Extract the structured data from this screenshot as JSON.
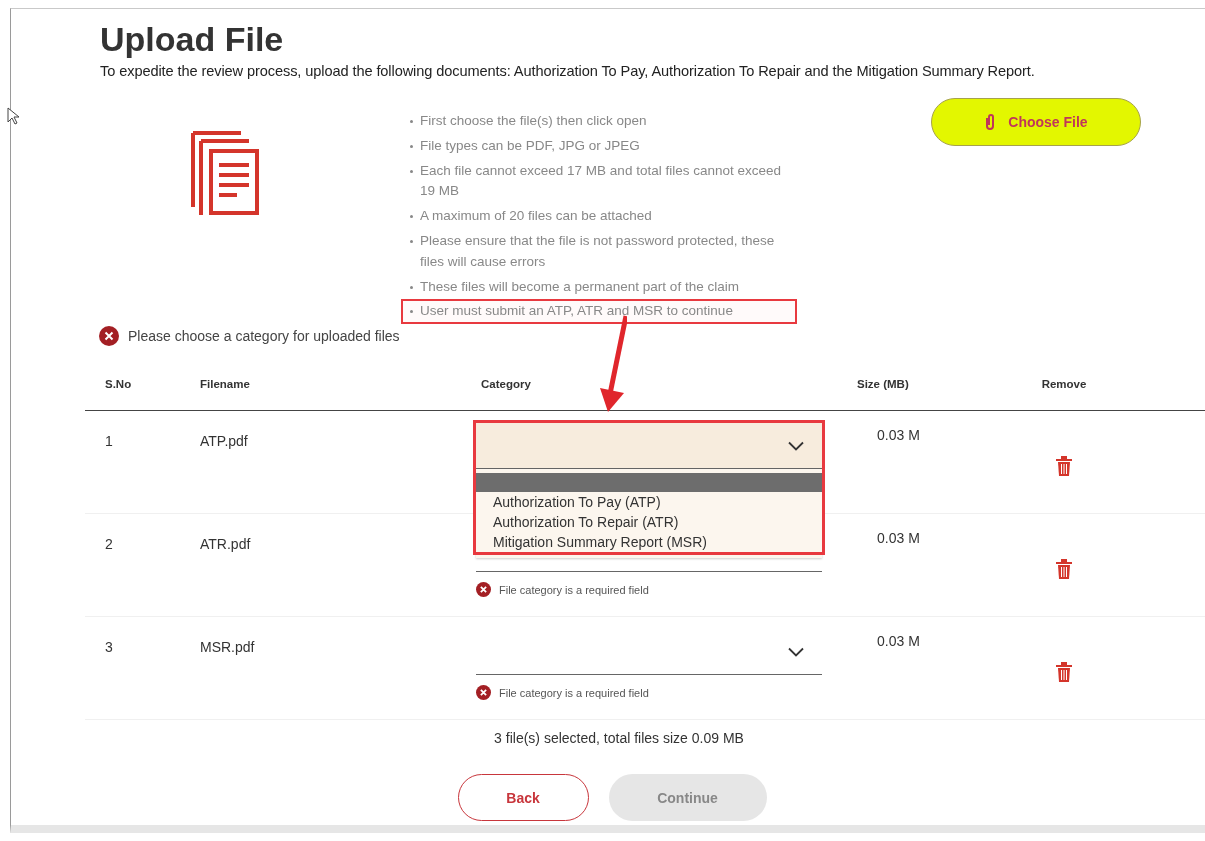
{
  "title": "Upload File",
  "subtitle": "To expedite the review process, upload the following documents: Authorization To Pay, Authorization To Repair and the Mitigation Summary Report.",
  "notes": [
    {
      "text": "First choose the file(s) then click open",
      "highlighted": false
    },
    {
      "text": "File types can be PDF, JPG or JPEG",
      "highlighted": false
    },
    {
      "text": "Each file cannot exceed 17 MB and total files cannot exceed 19 MB",
      "highlighted": false
    },
    {
      "text": "A maximum of 20 files can be attached",
      "highlighted": false
    },
    {
      "text": "Please ensure that the file is not password protected, these files will cause errors",
      "highlighted": false
    },
    {
      "text": "These files will become a permanent part of the claim",
      "highlighted": false
    },
    {
      "text": "User must submit an ATP, ATR and MSR to continue",
      "highlighted": true
    }
  ],
  "choose_button": "Choose File",
  "error_message": "Please choose a category for uploaded files",
  "table": {
    "columns": [
      "S.No",
      "Filename",
      "Category",
      "Size (MB)",
      "Remove"
    ],
    "rows": [
      {
        "sno": "1",
        "filename": "ATP.pdf",
        "size": "0.03 M",
        "expanded": true
      },
      {
        "sno": "2",
        "filename": "ATR.pdf",
        "size": "0.03 M",
        "expanded": false,
        "error": "File category is a required field"
      },
      {
        "sno": "3",
        "filename": "MSR.pdf",
        "size": "0.03 M",
        "expanded": false,
        "error": "File category is a required field"
      }
    ]
  },
  "dropdown": {
    "blank_option_highlighted": true,
    "highlighted": true,
    "options": [
      {
        "label": "Authorization To Pay (ATP)",
        "selected": false
      },
      {
        "label": "Authorization To Repair (ATR)",
        "selected": false
      },
      {
        "label": "Mitigation Summary Report (MSR)",
        "selected": false
      }
    ]
  },
  "annotation_arrow": true,
  "summary": "3 file(s) selected, total files size 0.09 MB",
  "buttons": [
    {
      "label": "Back",
      "disabled": false
    },
    {
      "label": "Continue",
      "disabled": true
    }
  ]
}
